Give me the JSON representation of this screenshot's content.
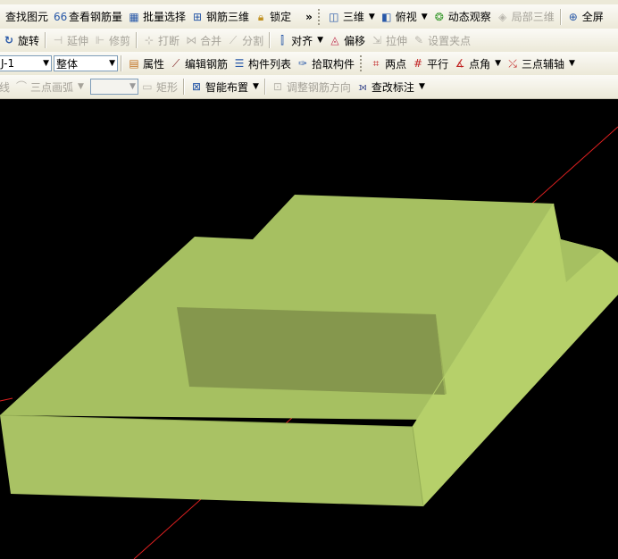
{
  "toolbar1": {
    "find_element": "查找图元",
    "view_rebar_qty": "查看钢筋量",
    "batch_select": "批量选择",
    "rebar_3d": "钢筋三维",
    "lock": "锁定",
    "overflow": "»",
    "view_3d": "三维",
    "top_view": "俯视",
    "dynamic_observe": "动态观察",
    "local_3d": "局部三维",
    "fullscreen": "全屏"
  },
  "toolbar2": {
    "rotate": "旋转",
    "extend": "延伸",
    "trim": "修剪",
    "break": "打断",
    "merge": "合并",
    "split": "分割",
    "align": "对齐",
    "offset": "偏移",
    "stretch": "拉伸",
    "set_grip": "设置夹点"
  },
  "toolbar3": {
    "component_value": "J-1",
    "scope_value": "整体",
    "properties": "属性",
    "edit_rebar": "编辑钢筋",
    "component_list": "构件列表",
    "pick_component": "拾取构件",
    "two_points": "两点",
    "parallel": "平行",
    "point_angle": "点角",
    "three_point_axis": "三点辅轴"
  },
  "toolbar4": {
    "line": "线",
    "three_point_arc": "三点画弧",
    "dropdown_value": "",
    "rectangle": "矩形",
    "smart_layout": "智能布置",
    "adjust_rebar_dir": "调整钢筋方向",
    "check_annotation": "查改标注"
  },
  "scene": {
    "background": "#000000",
    "model_color": "#a8c35e",
    "axis_color": "#ff2020"
  }
}
